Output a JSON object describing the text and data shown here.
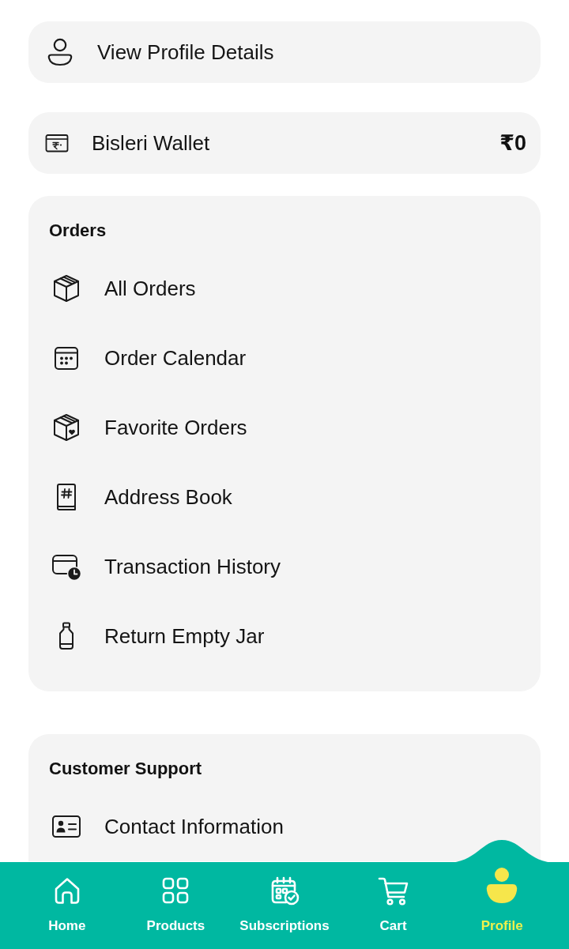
{
  "profile_link": {
    "label": "View Profile Details"
  },
  "wallet": {
    "label": "Bisleri Wallet",
    "balance": "₹0"
  },
  "sections": [
    {
      "title": "Orders",
      "items": [
        {
          "label": "All Orders"
        },
        {
          "label": "Order Calendar"
        },
        {
          "label": "Favorite Orders"
        },
        {
          "label": "Address Book"
        },
        {
          "label": "Transaction History"
        },
        {
          "label": "Return Empty Jar"
        }
      ]
    },
    {
      "title": "Customer Support",
      "items": [
        {
          "label": "Contact Information"
        }
      ]
    }
  ],
  "bottom_nav": [
    {
      "label": "Home",
      "selected": false
    },
    {
      "label": "Products",
      "selected": false
    },
    {
      "label": "Subscriptions",
      "selected": false
    },
    {
      "label": "Cart",
      "selected": false
    },
    {
      "label": "Profile",
      "selected": true
    }
  ]
}
